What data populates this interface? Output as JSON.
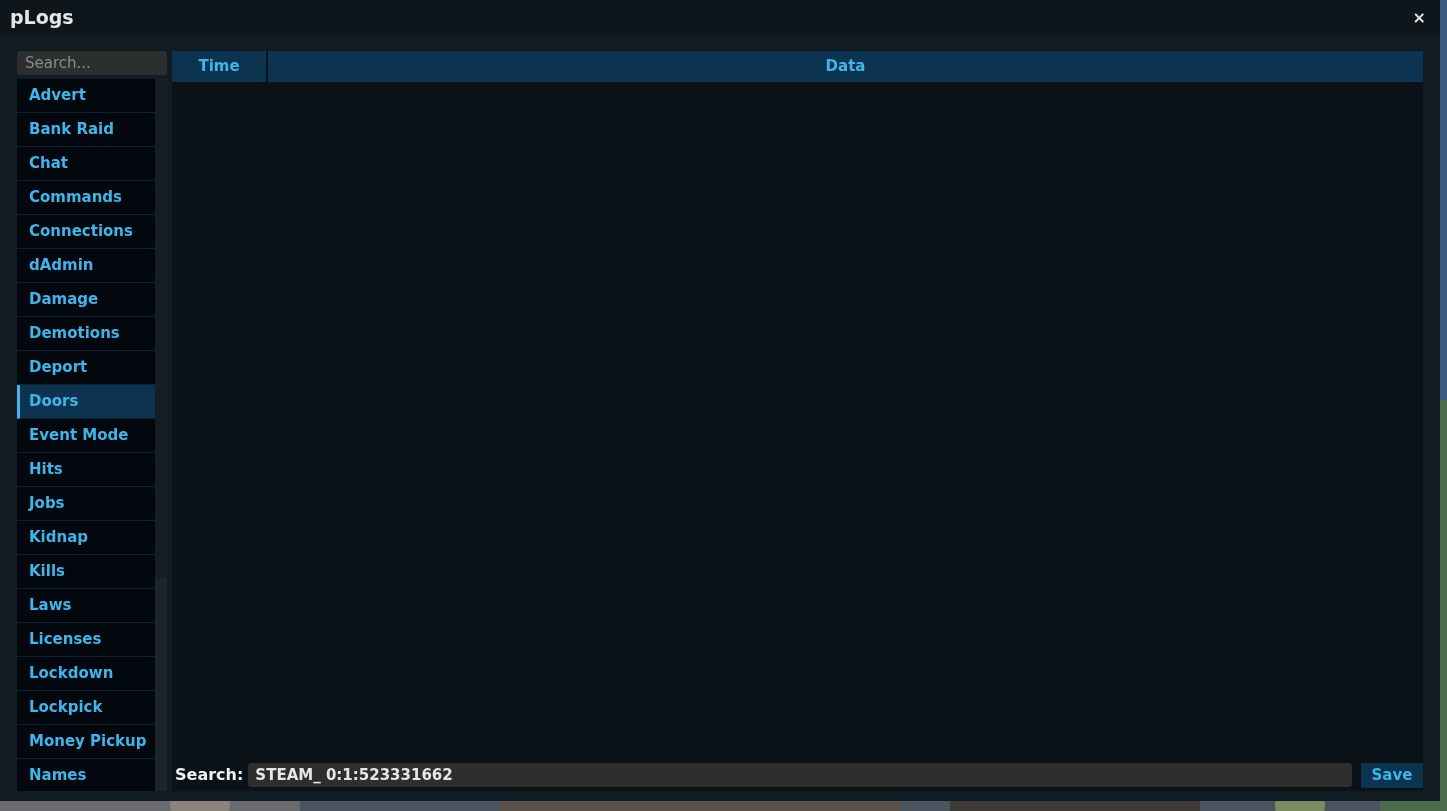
{
  "window": {
    "title": "pLogs",
    "close": "×"
  },
  "sidebar": {
    "search": {
      "placeholder": "Search..."
    },
    "items": [
      {
        "label": "Advert",
        "selected": false
      },
      {
        "label": "Bank Raid",
        "selected": false
      },
      {
        "label": "Chat",
        "selected": false
      },
      {
        "label": "Commands",
        "selected": false
      },
      {
        "label": "Connections",
        "selected": false
      },
      {
        "label": "dAdmin",
        "selected": false
      },
      {
        "label": "Damage",
        "selected": false
      },
      {
        "label": "Demotions",
        "selected": false
      },
      {
        "label": "Deport",
        "selected": false
      },
      {
        "label": "Doors",
        "selected": true
      },
      {
        "label": "Event Mode",
        "selected": false
      },
      {
        "label": "Hits",
        "selected": false
      },
      {
        "label": "Jobs",
        "selected": false
      },
      {
        "label": "Kidnap",
        "selected": false
      },
      {
        "label": "Kills",
        "selected": false
      },
      {
        "label": "Laws",
        "selected": false
      },
      {
        "label": "Licenses",
        "selected": false
      },
      {
        "label": "Lockdown",
        "selected": false
      },
      {
        "label": "Lockpick",
        "selected": false
      },
      {
        "label": "Money Pickup",
        "selected": false
      },
      {
        "label": "Names",
        "selected": false
      }
    ]
  },
  "table": {
    "columns": [
      "Time",
      "Data"
    ]
  },
  "footer": {
    "search_label": "Search:",
    "search_value": "STEAM_ 0:1:523331662",
    "button": "Save"
  }
}
